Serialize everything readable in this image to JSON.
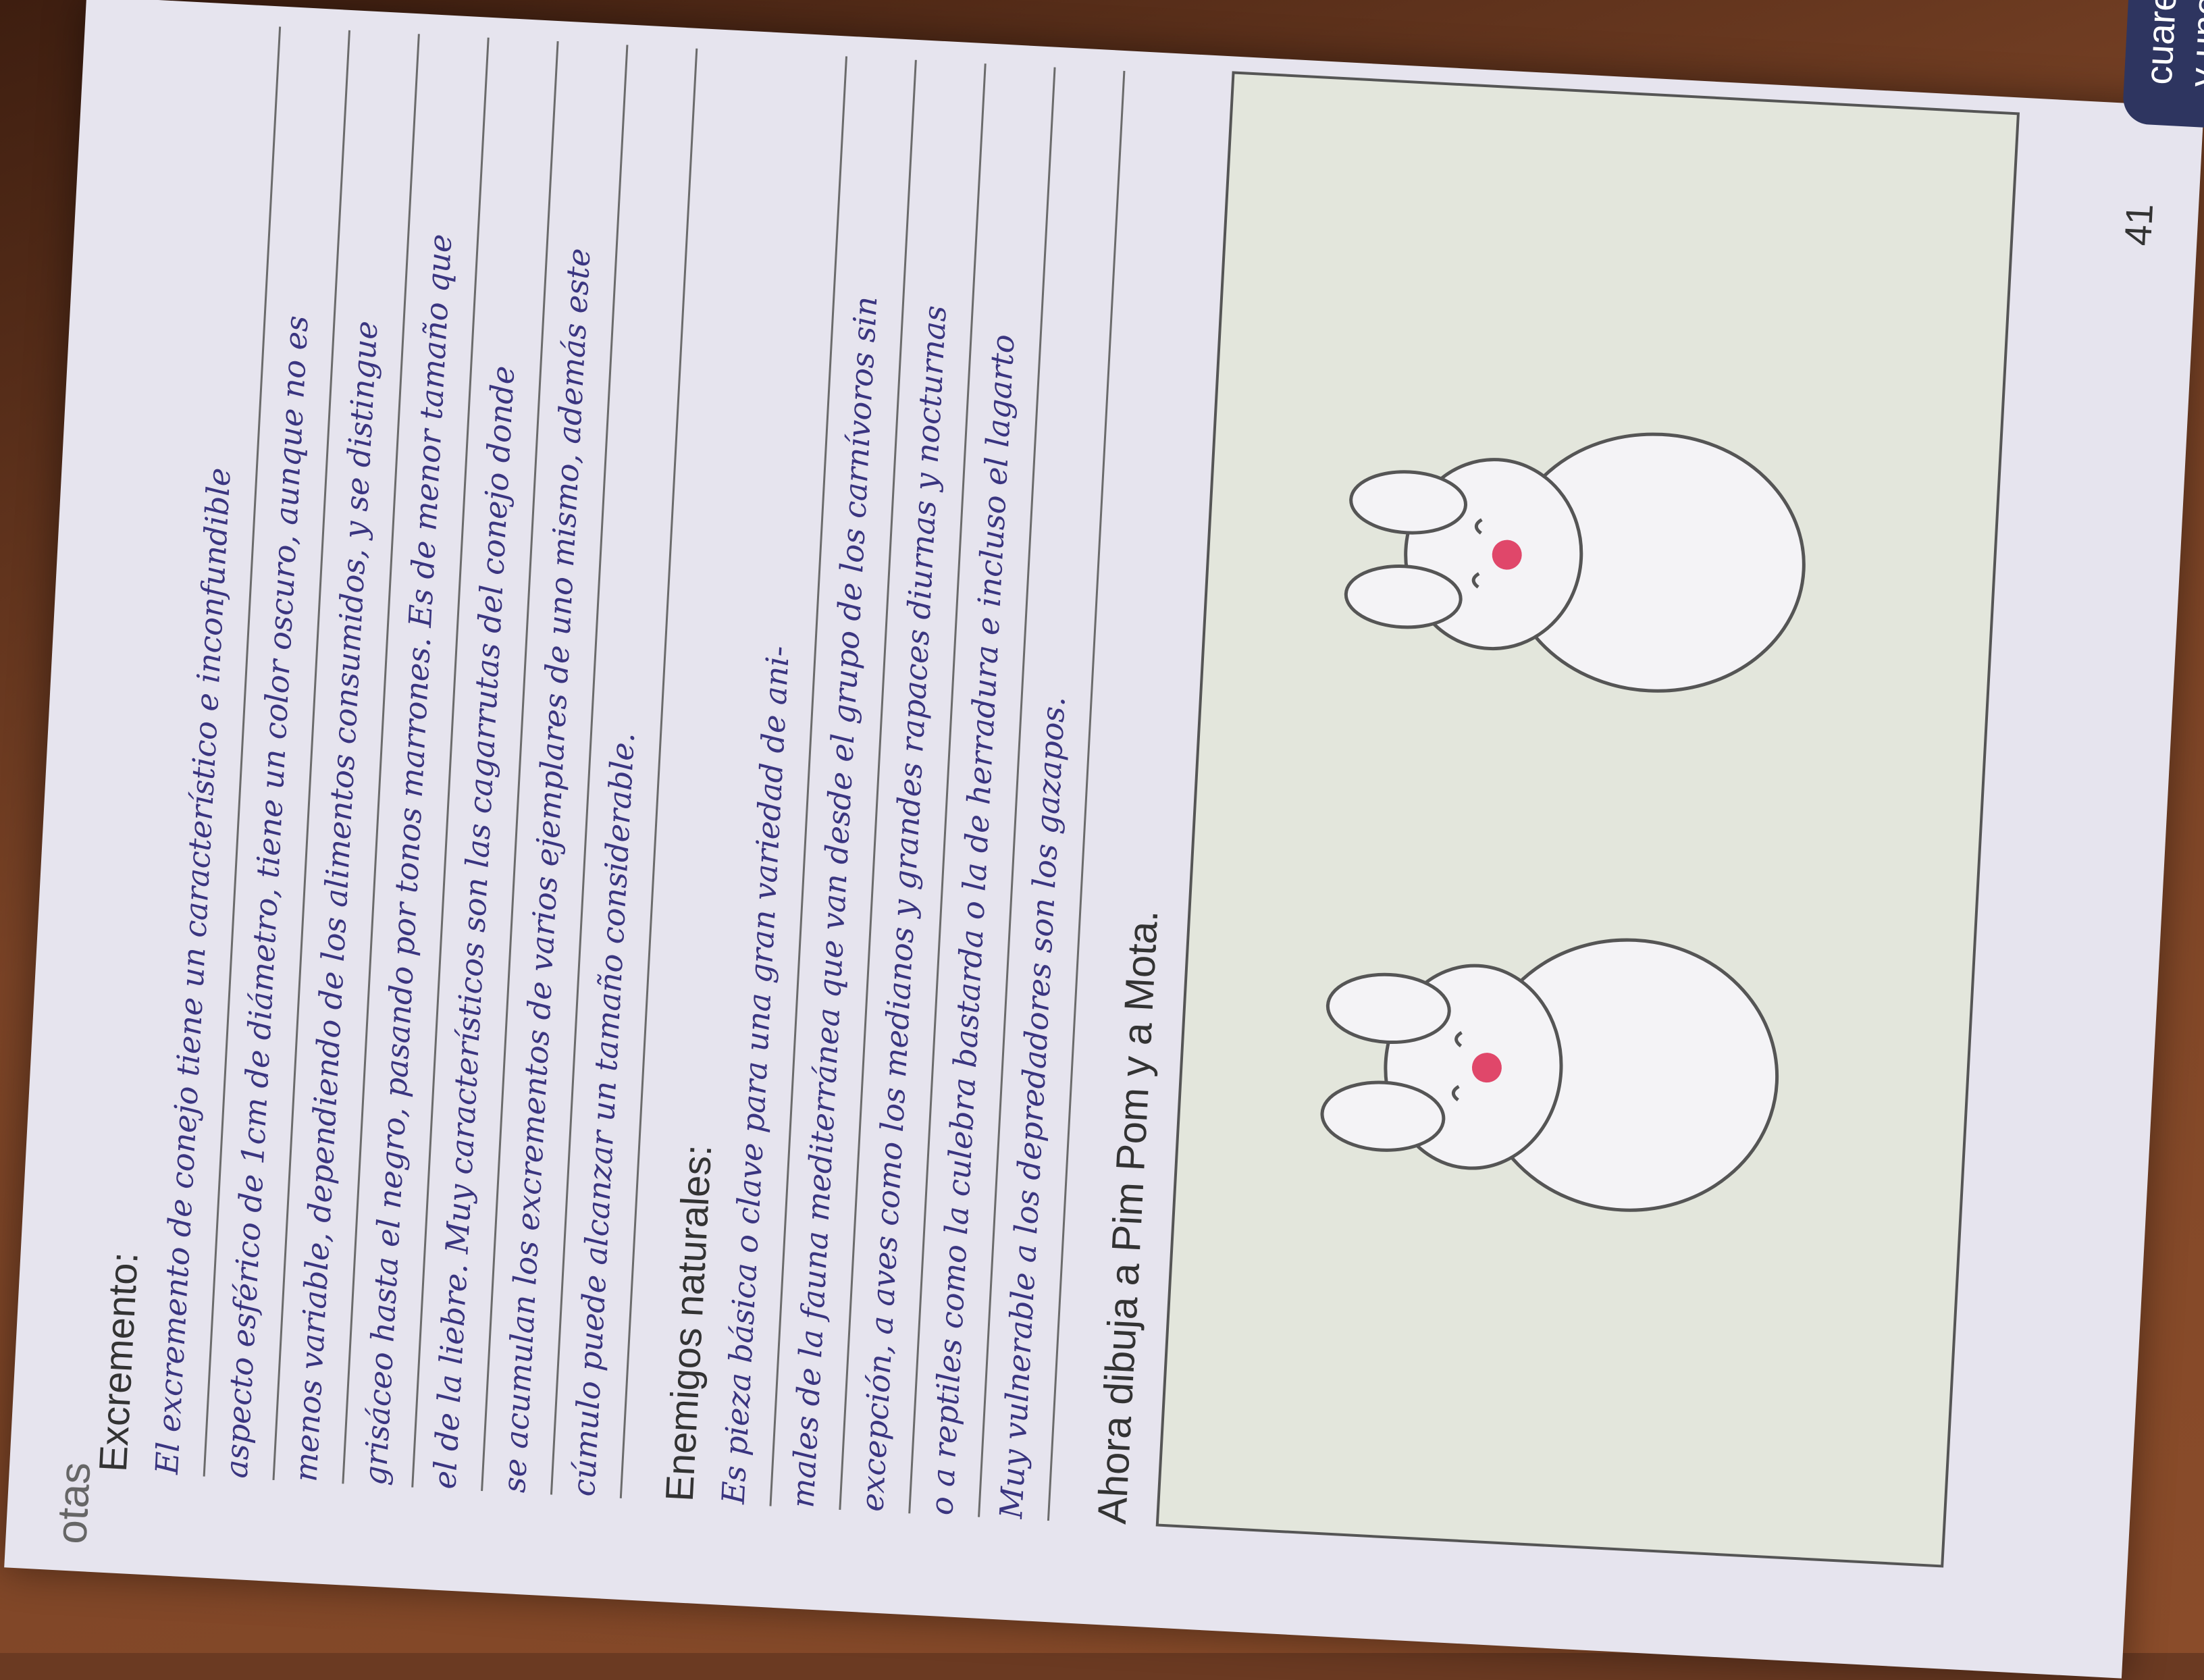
{
  "side_label": "otas",
  "excremento": {
    "label": "Excremento:",
    "lines": [
      "El excremento de conejo tiene un característico e inconfundible",
      "aspecto esférico de 1cm de diámetro, tiene un color oscuro, aunque no es",
      "menos variable, dependiendo de los alimentos consumidos, y se distingue",
      "grisáceo hasta el negro, pasando por tonos marrones. Es de menor tamaño que",
      "el de la liebre. Muy característicos son las cagarrutas del conejo donde",
      "se acumulan los excrementos de varios ejemplares de uno mismo, además este",
      "cúmulo puede alcanzar un tamaño considerable."
    ]
  },
  "enemigos": {
    "label": "Enemigos naturales:",
    "lines": [
      "Es pieza básica o clave para una gran variedad de ani-",
      "males de la fauna mediterránea que van desde el grupo de los carnívoros sin",
      "excepción, a aves como los medianos y grandes rapaces diurnas y nocturnas",
      "o a reptiles como la culebra bastarda o la de herradura e incluso el lagarto",
      "Muy vulnerable a los depredadores son los gazapos."
    ]
  },
  "instruction": "Ahora dibuja a Pim Pom y a Mota.",
  "footer": {
    "text": "cuarenta y uno",
    "page_number": "41"
  },
  "colors": {
    "page": "#e6e4ee",
    "ink_blue": "#3a3580",
    "ink_pink": "#e0476a",
    "drawing_bg": "#e3e6dc",
    "footer_badge": "#2e3560"
  }
}
